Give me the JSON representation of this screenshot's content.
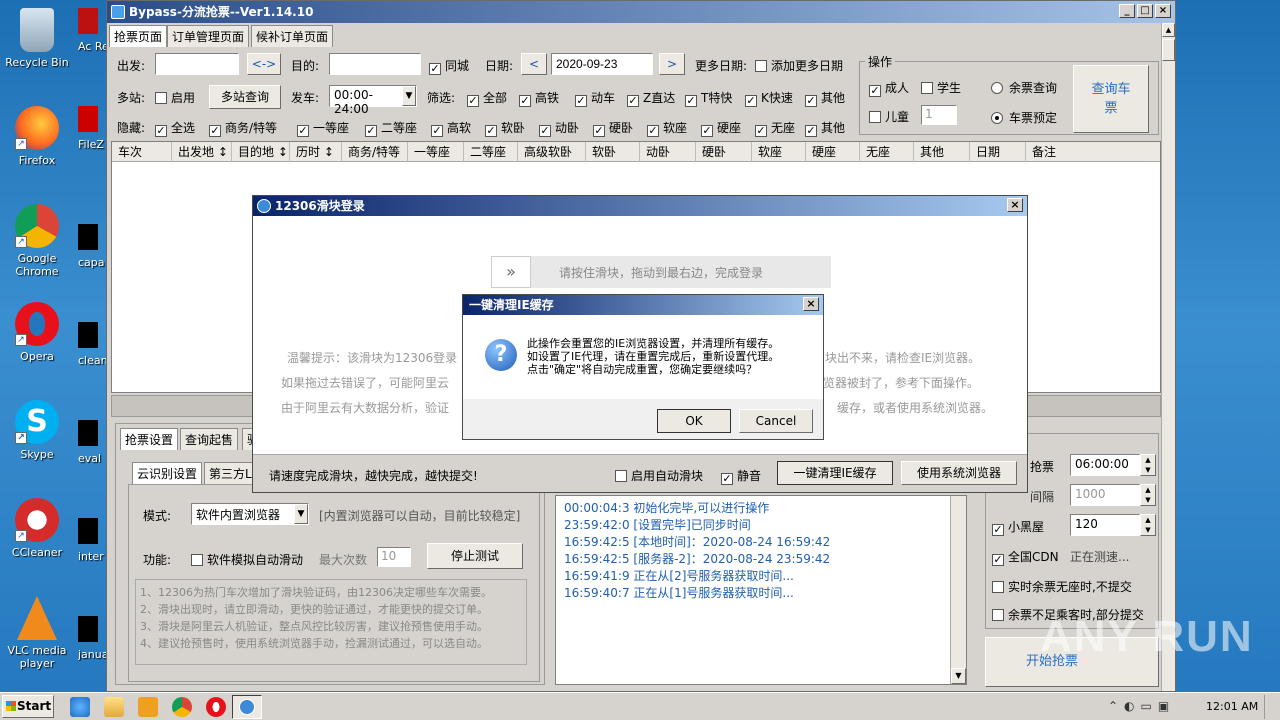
{
  "desktop": {
    "icons": [
      {
        "label": "Recycle Bin"
      },
      {
        "label": "Firefox"
      },
      {
        "label": "Google Chrome"
      },
      {
        "label": "Opera"
      },
      {
        "label": "Skype"
      },
      {
        "label": "CCleaner"
      },
      {
        "label": "VLC media player"
      }
    ],
    "peek": [
      "Ac Rea",
      "FileZ",
      "capa",
      "clean",
      "eval",
      "inter",
      "janua"
    ]
  },
  "window": {
    "title": "Bypass-分流抢票--Ver1.14.10",
    "tabs": [
      "抢票页面",
      "订单管理页面",
      "候补订单页面"
    ],
    "row1": {
      "from_label": "出发:",
      "from_value": "",
      "swap": "<->",
      "to_label": "目的:",
      "to_value": "",
      "same_city": "同城",
      "date_label": "日期:",
      "date_prev": "<",
      "date_value": "2020-09-23",
      "date_next": ">",
      "more_dates": "更多日期:",
      "add_dates": "添加更多日期"
    },
    "row2": {
      "multi_label": "多站:",
      "enable": "启用",
      "multi_query": "多站查询",
      "depart_label": "发车:",
      "depart_value": "00:00-24:00",
      "filter_label": "筛选:",
      "filters": [
        "全部",
        "高铁",
        "动车",
        "Z直达",
        "T特快",
        "K快速",
        "其他"
      ]
    },
    "row3": {
      "hide_label": "隐藏:",
      "items": [
        "全选",
        "商务/特等",
        "一等座",
        "二等座",
        "高软",
        "软卧",
        "动卧",
        "硬卧",
        "软座",
        "硬座",
        "无座",
        "其他"
      ]
    },
    "ops": {
      "title": "操作",
      "adult": "成人",
      "student": "学生",
      "child": "儿童",
      "child_count": "1",
      "remain_query": "余票查询",
      "ticket_booking": "车票预定",
      "query_button": "查询车票"
    },
    "columns": [
      "车次",
      "出发地 ↕",
      "目的地 ↕",
      "历时 ↕",
      "商务/特等",
      "一等座",
      "二等座",
      "高级软卧",
      "软卧",
      "动卧",
      "硬卧",
      "软座",
      "硬座",
      "无座",
      "其他",
      "日期",
      "备注"
    ],
    "bottom_tabs": [
      "抢票设置",
      "查询起售",
      "验"
    ],
    "sub_tabs": [
      "云识别设置",
      "第三方L"
    ],
    "mode_label": "模式:",
    "mode_value": "软件内置浏览器",
    "mode_hint": "[内置浏览器可以自动，目前比较稳定]",
    "func_label": "功能:",
    "func_check": "软件模拟自动滑动",
    "max_label": "最大次数",
    "max_value": "10",
    "stop_test": "停止测试",
    "notes": [
      "1、12306为热门车次增加了滑块验证码，由12306决定哪些车次需要。",
      "2、滑块出现时，请立即滑动，更快的验证通过，才能更快的提交订单。",
      "3、滑块是阿里云人机验证，整点风控比较厉害，建议抢预售使用手动。",
      "4、建议抢预售时，使用系统浏览器手动，捡漏测试通过，可以选自动。"
    ],
    "log": [
      "00:00:04:3  初始化完毕,可以进行操作",
      "23:59:42:0  [设置完毕]已同步时间",
      "16:59:42:5  [本地时间]：2020-08-24 16:59:42",
      "16:59:42:5  [服务器-2]：2020-08-24 23:59:42",
      "16:59:41:9  正在从[2]号服务器获取时间...",
      "16:59:40:7  正在从[1]号服务器获取时间..."
    ],
    "right_panel": {
      "timer_label": "抢票",
      "timer_value": "06:00:00",
      "interval_label": "间隔",
      "interval_value": "1000",
      "blackroom_label": "小黑屋",
      "blackroom_value": "120",
      "cdn_label": "全国CDN",
      "cdn_status": "正在测速...",
      "realtime_label": "实时余票无座时,不提交",
      "partial_label": "余票不足乘客时,部分提交",
      "start_button": "开始抢票"
    }
  },
  "slider_dialog": {
    "title": "12306滑块登录",
    "slider_text": "请按住滑块，拖动到最右边，完成登录",
    "tip_lines": [
      {
        "left": "温馨提示：该滑块为12306登录",
        "right": "块出不来，请检查IE浏览器。"
      },
      {
        "left": "如果拖过去错误了，可能阿里云",
        "right": "览器被封了，参考下面操作。"
      },
      {
        "left": "由于阿里云有大数据分析，验证",
        "right": "缓存，或者使用系统浏览器。"
      }
    ],
    "footer_text": "请速度完成滑块，越快完成，越快提交!",
    "auto_slide": "启用自动滑块",
    "mute": "静音",
    "clear_cache_button": "一键清理IE缓存",
    "system_browser_button": "使用系统浏览器"
  },
  "confirm_dialog": {
    "title": "一键清理IE缓存",
    "message_lines": [
      "此操作会重置您的IE浏览器设置，并清理所有缓存。",
      "如设置了IE代理，请在重置完成后，重新设置代理。",
      "点击\"确定\"将自动完成重置，您确定要继续吗？"
    ],
    "ok": "OK",
    "cancel": "Cancel"
  },
  "taskbar": {
    "start": "Start",
    "clock": "12:01 AM"
  },
  "watermark": "ANY RUN"
}
